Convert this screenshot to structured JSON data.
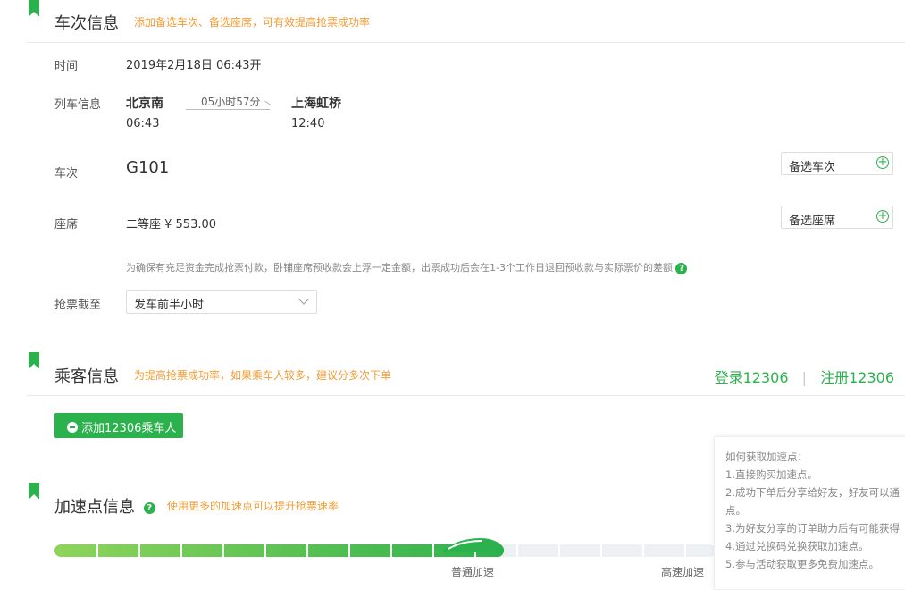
{
  "train_section": {
    "title": "车次信息",
    "tip": "添加备选车次、备选座席，可有效提高抢票成功率",
    "time_label": "时间",
    "time_value": "2019年2月18日 06:43开",
    "train_info_label": "列车信息",
    "from_station": "北京南",
    "from_time": "06:43",
    "duration": "05小时57分",
    "to_station": "上海虹桥",
    "to_time": "12:40",
    "train_no_label": "车次",
    "train_no": "G101",
    "alt_train_button": "备选车次",
    "seat_label": "座席",
    "seat_value": "二等座 ¥ 553.00",
    "alt_seat_button": "备选座席",
    "deposit_note": "为确保有充足资金完成抢票付款，卧铺座席预收款会上浮一定金额，出票成功后会在1-3个工作日退回预收款与实际票价的差额",
    "deadline_label": "抢票截至",
    "deadline_value": "发车前半小时"
  },
  "passenger_section": {
    "title": "乘客信息",
    "tip": "为提高抢票成功率，如果乘车人较多，建议分多次下单",
    "login_link": "登录12306",
    "separator": "|",
    "register_link": "注册12306",
    "add_button": "添加12306乘车人"
  },
  "speed_section": {
    "title": "加速点信息",
    "tip": "使用更多的加速点可以提升抢票速率",
    "progress_fraction": 0.68,
    "level_normal": "普通加速",
    "level_high": "高速加速"
  },
  "speed_popup": {
    "lines": [
      "如何获取加速点：",
      "1.直接购买加速点。",
      "2.成功下单后分享给好友，好友可以通",
      "点。",
      "3.为好友分享的订单助力后有可能获得",
      "4.通过兑换码兑换获取加速点。",
      "5.参与活动获取更多免费加速点。"
    ]
  },
  "colors": {
    "accent": "#2bb24c",
    "tip": "#f39c36"
  },
  "icons": {
    "help": "question-circle-icon",
    "plus": "plus-circle-icon",
    "chevron": "chevron-down-icon"
  },
  "help_glyph": "?",
  "plus_glyph": "+"
}
